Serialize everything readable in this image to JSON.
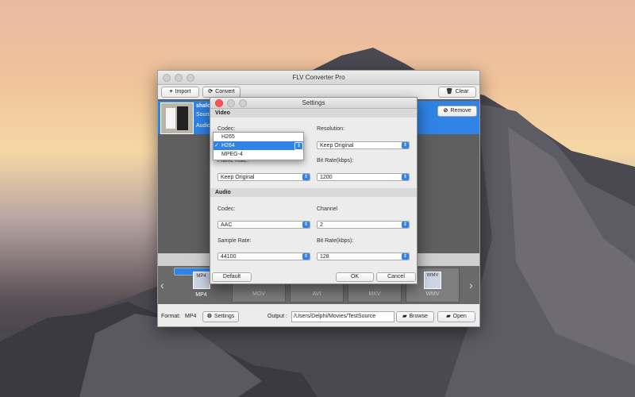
{
  "app": {
    "title": "FLV Converter Pro",
    "toolbar": {
      "import_label": "Import",
      "convert_label": "Convert",
      "clear_label": "Clear"
    },
    "file_row": {
      "name": "shalo",
      "source_label": "Sourc",
      "audio_label": "Audio",
      "remove_label": "Remove"
    },
    "formats": {
      "items": [
        {
          "label": "MP4",
          "selected": true
        },
        {
          "label": "MOV",
          "selected": false
        },
        {
          "label": "AVI",
          "selected": false
        },
        {
          "label": "MKV",
          "selected": false
        },
        {
          "label": "WMV",
          "selected": false
        }
      ],
      "mp4_badge": "MP4",
      "wmv_badge": "WMV"
    },
    "status": {
      "format_label": "Format:",
      "format_value": "MP4",
      "settings_label": "Settings",
      "output_label": "Output :",
      "output_path": "/Users/Delphi/Movies/TestSource",
      "browse_label": "Browse",
      "open_label": "Open"
    }
  },
  "settings": {
    "title": "Settings",
    "video_section": "Video",
    "audio_section": "Audio",
    "codec_label": "Codec:",
    "resolution_label": "Resolution:",
    "resolution_value": "Keep Original",
    "frame_rate_label": "Frame Rate:",
    "frame_rate_value": "Keep Original",
    "video_bitrate_label": "Bit Rate(kbps):",
    "video_bitrate_value": "1200",
    "audio_codec_label": "Codec:",
    "audio_codec_value": "AAC",
    "channel_label": "Channel",
    "channel_value": "2",
    "sample_rate_label": "Sample Rate:",
    "sample_rate_value": "44100",
    "audio_bitrate_label": "Bit Rate(kbps):",
    "audio_bitrate_value": "128",
    "default_label": "Default",
    "ok_label": "OK",
    "cancel_label": "Cancel",
    "codec_options": [
      "H265",
      "H264",
      "MPEG-4"
    ],
    "codec_selected": "H264",
    "check_mark": "✓"
  },
  "colors": {
    "accent": "#2f84e6",
    "close_red": "#fc5753"
  }
}
